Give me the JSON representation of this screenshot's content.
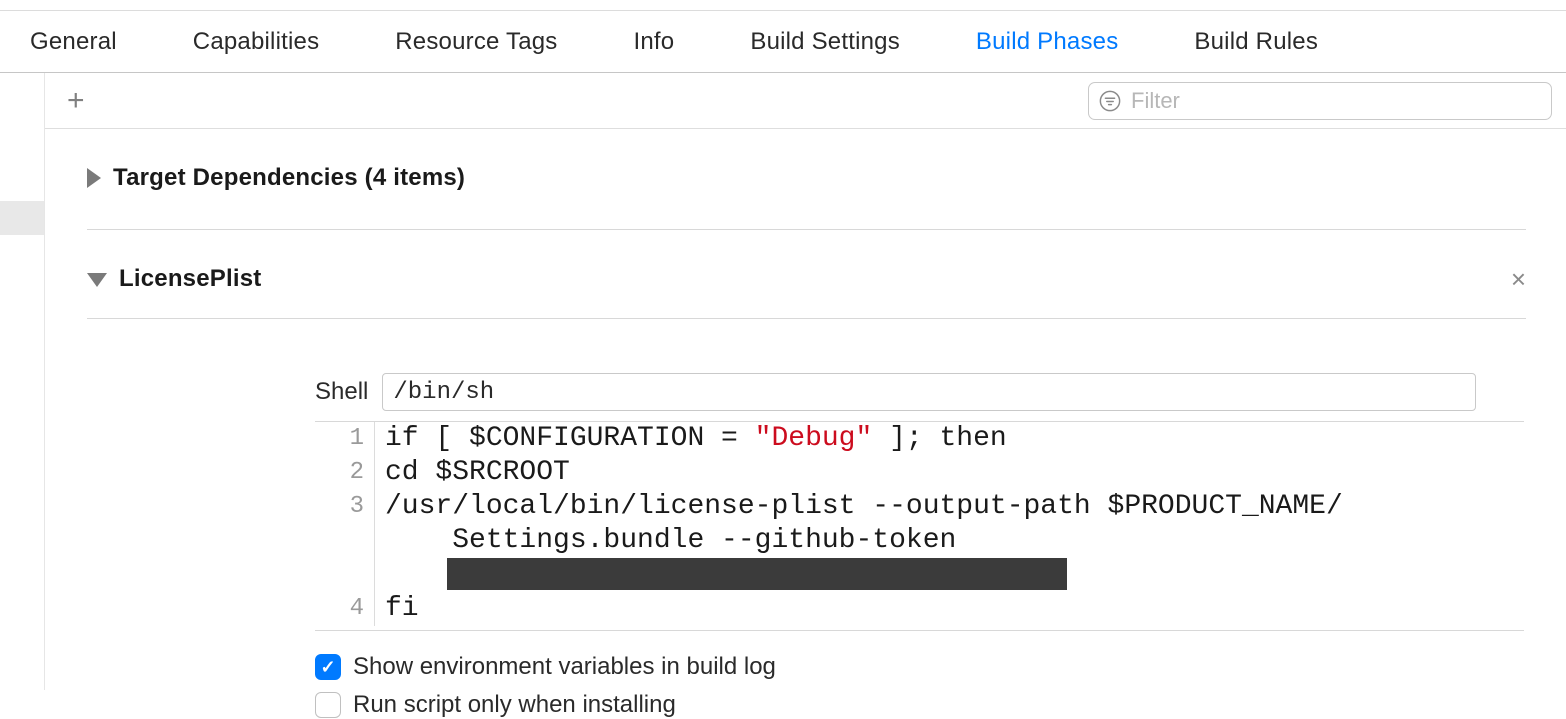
{
  "tabs": {
    "general": "General",
    "capabilities": "Capabilities",
    "resource_tags": "Resource Tags",
    "info": "Info",
    "build_settings": "Build Settings",
    "build_phases": "Build Phases",
    "build_rules": "Build Rules"
  },
  "filter": {
    "placeholder": "Filter"
  },
  "phase1": {
    "title": "Target Dependencies (4 items)"
  },
  "phase2": {
    "title": "LicensePlist",
    "shell_label": "Shell",
    "shell_value": "/bin/sh",
    "code": {
      "line1_prefix": "if [ $CONFIGURATION = ",
      "line1_string": "\"Debug\"",
      "line1_suffix": " ]; then",
      "line2": "cd $SRCROOT",
      "line3a": "/usr/local/bin/license-plist --output-path $PRODUCT_NAME/",
      "line3b": "    Settings.bundle --github-token",
      "line4": "fi",
      "numbers": {
        "n1": "1",
        "n2": "2",
        "n3": "3",
        "n4": "4"
      }
    },
    "check1": "Show environment variables in build log",
    "check2": "Run script only when installing"
  }
}
